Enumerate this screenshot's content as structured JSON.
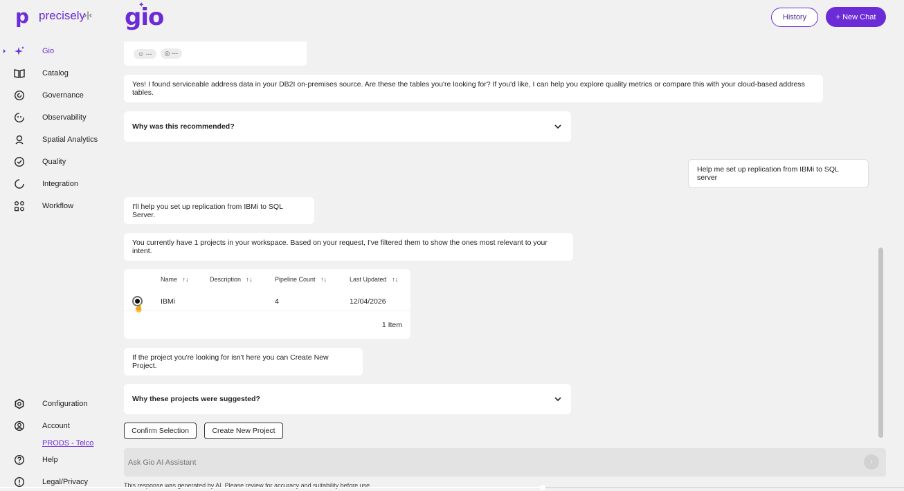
{
  "header": {
    "brand": "precisely",
    "collapse_icon": "›|‹",
    "app_logo": "gio",
    "history_label": "History",
    "new_chat_label": "+ New Chat"
  },
  "sidebar": {
    "items": [
      {
        "label": "Gio",
        "icon": "sparkle-icon",
        "glyph": "✦"
      },
      {
        "label": "Catalog",
        "icon": "book-icon",
        "glyph": "🕮"
      },
      {
        "label": "Governance",
        "icon": "governance-icon",
        "glyph": "◎"
      },
      {
        "label": "Observability",
        "icon": "observability-icon",
        "glyph": "◔"
      },
      {
        "label": "Spatial Analytics",
        "icon": "location-pin-icon",
        "glyph": "⌖"
      },
      {
        "label": "Quality",
        "icon": "quality-check-icon",
        "glyph": "✓"
      },
      {
        "label": "Integration",
        "icon": "integration-icon",
        "glyph": "◌"
      },
      {
        "label": "Workflow",
        "icon": "workflow-icon",
        "glyph": "∷"
      }
    ],
    "bottom_items": [
      {
        "label": "Configuration",
        "icon": "gear-icon"
      },
      {
        "label": "Account",
        "icon": "account-icon"
      },
      {
        "label": "Help",
        "icon": "help-icon"
      },
      {
        "label": "Legal/Privacy",
        "icon": "info-icon"
      }
    ],
    "tenant": "PRODS - Telco"
  },
  "chat": {
    "reaction_pills": [
      "☺ ---",
      "◎ ---"
    ],
    "msg_found": "Yes! I found serviceable address data in your DB2I on-premises source. Are these the tables you're looking for? If you'd like, I can help you explore quality metrics or compare this with your cloud-based address tables.",
    "why_recommended": "Why was this recommended?",
    "user_msg": "Help me set up replication from IBMi to SQL server",
    "msg_help": "I'll help you set up replication from IBMi to SQL Server.",
    "msg_projects": "You currently have 1 projects in your workspace. Based on your request, I've filtered them to show the ones most relevant to your intent.",
    "table": {
      "columns": [
        "Name",
        "Description",
        "Pipeline Count",
        "Last Updated"
      ],
      "sort_icon": "↑↓",
      "rows": [
        {
          "name": "IBMi",
          "description": "",
          "pipeline_count": "4",
          "last_updated": "12/04/2026",
          "selected": true
        }
      ],
      "item_count": "1 Item"
    },
    "msg_create": "If the project you're looking for isn't here you can Create New Project.",
    "why_projects": "Why these projects were suggested?",
    "confirm_label": "Confirm Selection",
    "create_label": "Create New Project"
  },
  "input": {
    "placeholder": "Ask Gio AI Assistant",
    "send_icon": "↑"
  },
  "disclaimer": "This response was generated by AI. Please review for accuracy and suitability before use.",
  "video_progress": 0.6
}
